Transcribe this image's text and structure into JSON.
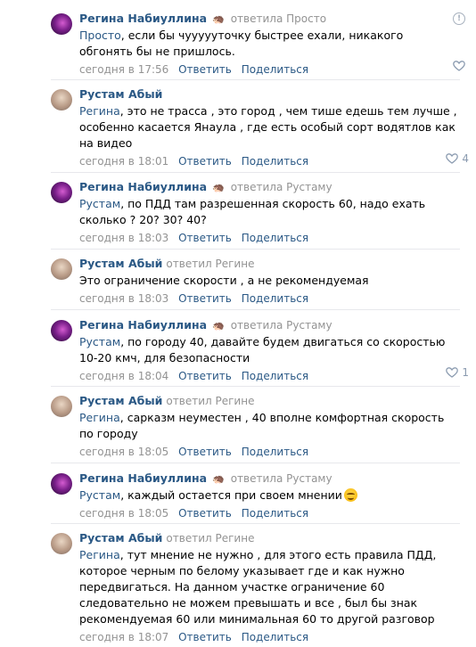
{
  "actions": {
    "reply": "Ответить",
    "share": "Поделиться"
  },
  "comments": [
    {
      "author": "Регина Набиуллина",
      "badge_icon": "hedgehog-icon",
      "reply_verb": "ответила",
      "reply_target": "Просто",
      "mention": "Просто",
      "text": ", если бы чуууууточку быстрее ехали, никакого обгонять бы не пришлось.",
      "time": "сегодня в 17:56",
      "likes": ""
    },
    {
      "author": "Рустам Абый",
      "reply_verb": "",
      "reply_target": "",
      "mention": "Регина",
      "text": ", это не трасса , это город , чем тише едешь тем лучше , особенно касается Янаула , где есть особый сорт водятлов как на видео",
      "time": "сегодня в 18:01",
      "likes": "4"
    },
    {
      "author": "Регина Набиуллина",
      "badge_icon": "hedgehog-icon",
      "reply_verb": "ответила",
      "reply_target": "Рустаму",
      "mention": "Рустам",
      "text": ", по ПДД там разрешенная скорость 60, надо ехать сколько ? 20? 30? 40?",
      "time": "сегодня в 18:03",
      "likes": ""
    },
    {
      "author": "Рустам Абый",
      "reply_verb": "ответил",
      "reply_target": "Регине",
      "mention": "",
      "text": "Это ограничение скорости , а не рекомендуемая",
      "time": "сегодня в 18:03",
      "likes": ""
    },
    {
      "author": "Регина Набиуллина",
      "badge_icon": "hedgehog-icon",
      "reply_verb": "ответила",
      "reply_target": "Рустаму",
      "mention": "Рустам",
      "text": ", по городу 40, давайте будем двигаться со скоростью 10-20 кмч, для безопасности",
      "time": "сегодня в 18:04",
      "likes": "1"
    },
    {
      "author": "Рустам Абый",
      "reply_verb": "ответил",
      "reply_target": "Регине",
      "mention": "Регина",
      "text": ", сарказм неуместен , 40 вполне комфортная скорость по городу",
      "time": "сегодня в 18:05",
      "likes": ""
    },
    {
      "author": "Регина Набиуллина",
      "badge_icon": "hedgehog-icon",
      "reply_verb": "ответила",
      "reply_target": "Рустаму",
      "mention": "Рустам",
      "text": ", каждый остается при своем мнении",
      "time": "сегодня в 18:05",
      "likes": ""
    },
    {
      "author": "Рустам Абый",
      "reply_verb": "ответил",
      "reply_target": "Регине",
      "mention": "Регина",
      "text": ", тут мнение не нужно , для этого есть правила ПДД, которое черным по белому указывает где и как нужно передвигаться. На данном участке ограничение 60 следовательно не можем превышать и все , был бы знак рекомендуемая 60 или минимальная 60 то другой разговор",
      "time": "сегодня в 18:07",
      "likes": ""
    }
  ]
}
